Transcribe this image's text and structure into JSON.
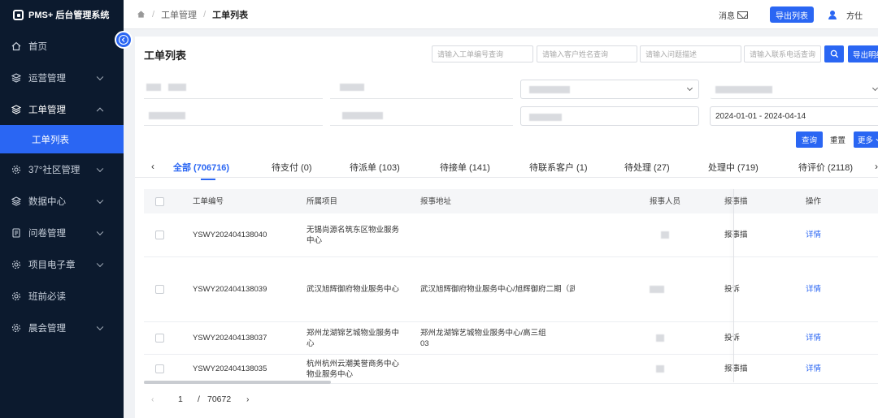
{
  "app": {
    "title": "PMS+ 后台管理系统"
  },
  "sidebar": {
    "items": [
      {
        "label": "首页",
        "icon": "home-icon"
      },
      {
        "label": "运营管理",
        "icon": "layers-icon"
      },
      {
        "label": "工单管理",
        "icon": "layers-icon",
        "open": true
      },
      {
        "label": "37°社区管理",
        "icon": "gear-icon"
      },
      {
        "label": "数据中心",
        "icon": "layers-icon"
      },
      {
        "label": "问卷管理",
        "icon": "document-icon"
      },
      {
        "label": "项目电子章",
        "icon": "gear-icon"
      },
      {
        "label": "班前必读",
        "icon": "gear-icon"
      },
      {
        "label": "晨会管理",
        "icon": "gear-icon"
      }
    ],
    "sub_item": "工单列表"
  },
  "header": {
    "breadcrumb": [
      "工单管理",
      "工单列表"
    ],
    "message": "消息",
    "export_list": "导出列表",
    "user": "方仕"
  },
  "page": {
    "title": "工单列表",
    "search": {
      "order_no": "请输入工单编号查询",
      "customer": "请输入客户姓名查询",
      "problem": "请输入问题描述",
      "phone": "请输入联系电话查询"
    },
    "export_detail": "导出明细",
    "date_range": "2024-01-01 - 2024-04-14",
    "query": "查询",
    "reset": "重置",
    "more": "更多"
  },
  "tabs": [
    {
      "label": "全部 (706716)",
      "active": true
    },
    {
      "label": "待支付 (0)"
    },
    {
      "label": "待派单 (103)"
    },
    {
      "label": "待接单 (141)"
    },
    {
      "label": "待联系客户 (1)"
    },
    {
      "label": "待处理 (27)"
    },
    {
      "label": "处理中 (719)"
    },
    {
      "label": "待评价 (2118)"
    }
  ],
  "table": {
    "columns": [
      "工单编号",
      "所属项目",
      "报事地址",
      "报事人员",
      "报事描",
      "操作"
    ],
    "rows": [
      {
        "order_no": "YSWY202404138040",
        "project": "无锡尚源名筑东区物业服务中心",
        "address": "",
        "type": "报事描",
        "action": "详情"
      },
      {
        "order_no": "YSWY202404138039",
        "project": "武汉旭辉御府物业服务中心",
        "address": "武汉旭辉御府物业服务中心/旭辉御府二期（武",
        "type": "投诉",
        "action": "详情"
      },
      {
        "order_no": "YSWY202404138037",
        "project": "郑州龙湖锦艺城物业服务中心",
        "address": "郑州龙湖锦艺城物业服务中心/高三组 03",
        "type": "投诉",
        "action": "详情"
      },
      {
        "order_no": "YSWY202404138035",
        "project": "杭州杭州云潮美誉商务中心物业服务中心",
        "address": "",
        "type": "报事描",
        "action": "详情"
      }
    ]
  },
  "pager": {
    "current": "1",
    "separator": "/",
    "total": "70672"
  },
  "colors": {
    "sidebar_bg": "#0c1a2e",
    "accent": "#2a66f3",
    "page_bg": "#f0f2f5"
  }
}
